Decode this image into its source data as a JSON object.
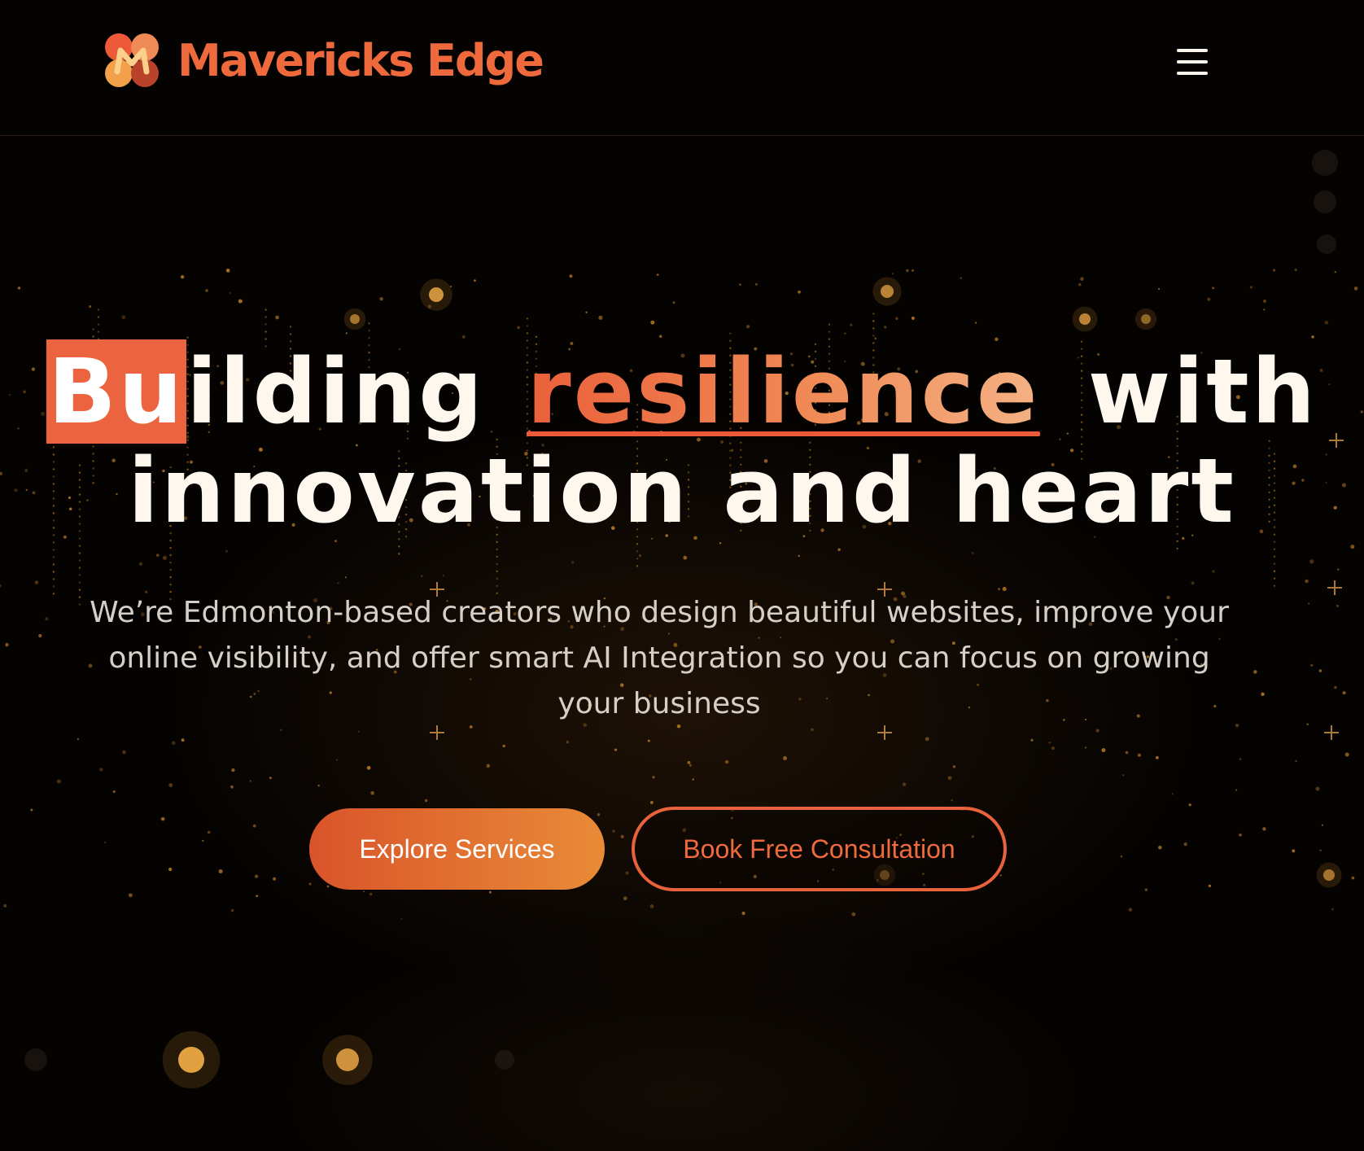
{
  "header": {
    "brand_name": "Mavericks Edge",
    "menu_icon": "hamburger-menu-icon"
  },
  "hero": {
    "title_box": "Bu",
    "title_rest": "ilding",
    "title_accent": "resilience",
    "title_with": "with",
    "title_line2": "innovation and heart",
    "subtitle": "We’re Edmonton-based creators who design beautiful websites, improve your online visibility, and offer smart AI Integration so you can focus on growing your business"
  },
  "actions": {
    "primary_label": "Explore Services",
    "secondary_label": "Book Free Consultation"
  },
  "colors": {
    "brand": "#ee6a3c",
    "accent_box": "#ec643f",
    "background": "#050302",
    "text": "#fdf7ee"
  }
}
